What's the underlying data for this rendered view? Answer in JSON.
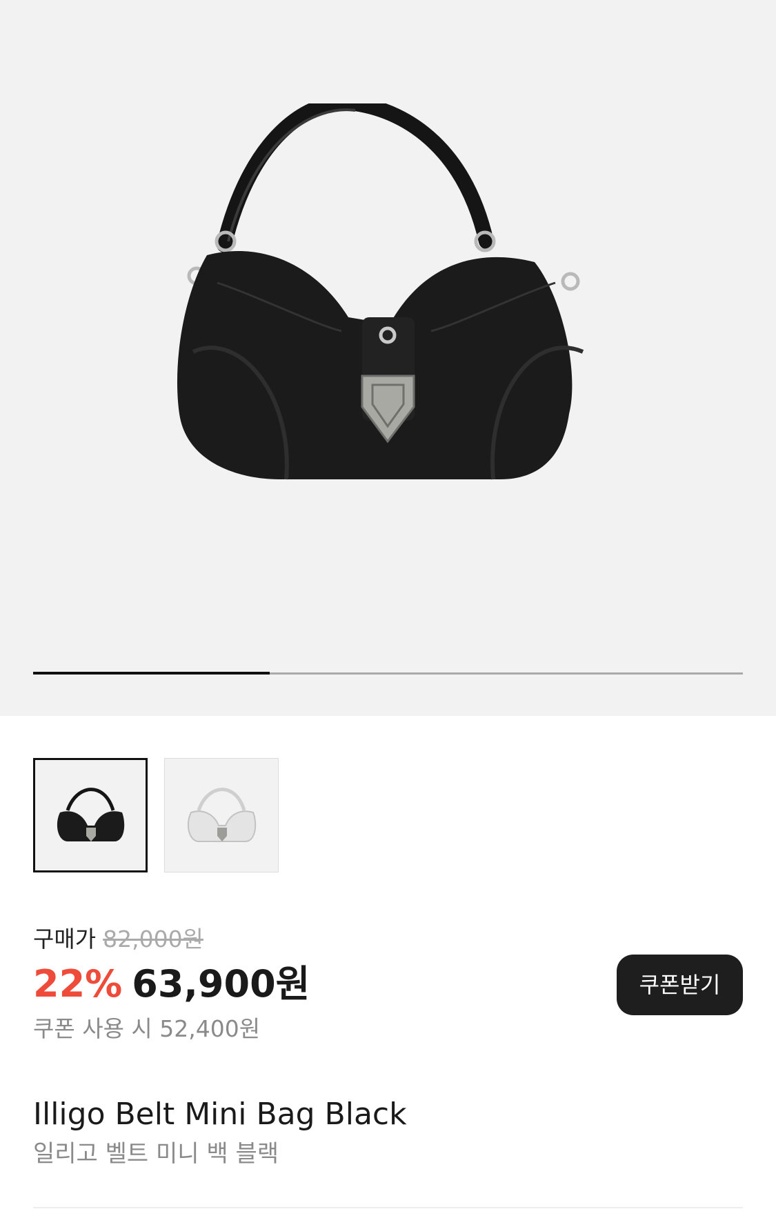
{
  "gallery": {
    "main_image": "black-shoulder-bag-image",
    "slide_progress": 0.333,
    "thumbnails": [
      {
        "image": "black-shoulder-bag-thumbnail",
        "selected": true
      },
      {
        "image": "silver-shoulder-bag-thumbnail",
        "selected": false
      }
    ]
  },
  "price": {
    "label": "구매가",
    "original": "82,000원",
    "discount": "22%",
    "final": "63,900원",
    "coupon_note": "쿠폰 사용 시 52,400원",
    "coupon_button": "쿠폰받기"
  },
  "product": {
    "name": "Illigo Belt Mini Bag Black",
    "name_korean": "일리고 벨트 미니 백 블랙"
  },
  "colors": {
    "discount": "#ef4b3a",
    "button_bg": "#1e1e1e",
    "hero_bg": "#f2f2f2"
  }
}
